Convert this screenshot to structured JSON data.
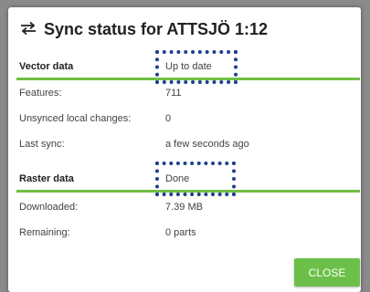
{
  "dialog": {
    "title": "Sync status for ATTSJÖ 1:12",
    "title_icon": "sync-arrows-icon",
    "close_label": "CLOSE"
  },
  "vector": {
    "heading": "Vector data",
    "status": "Up to date",
    "rows": [
      {
        "label": "Features:",
        "value": "711"
      },
      {
        "label": "Unsynced local changes:",
        "value": "0"
      },
      {
        "label": "Last sync:",
        "value": "a few seconds ago"
      }
    ]
  },
  "raster": {
    "heading": "Raster data",
    "status": "Done",
    "rows": [
      {
        "label": "Downloaded:",
        "value": "7.39 MB"
      },
      {
        "label": "Remaining:",
        "value": "0 parts"
      }
    ]
  },
  "colors": {
    "accent_green": "#6fbf44",
    "highlight_blue": "#1d3f8e"
  }
}
